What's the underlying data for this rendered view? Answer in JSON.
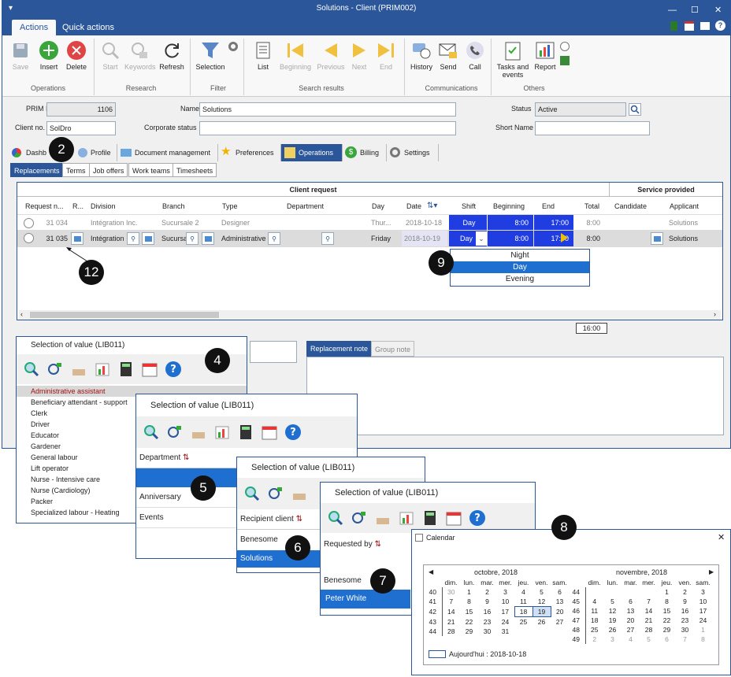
{
  "window": {
    "title": "Solutions - Client (PRIM002)",
    "menu_glyph": "▾"
  },
  "ribbon_tabs": [
    "Actions",
    "Quick actions"
  ],
  "ribbon": {
    "operations": {
      "label": "Operations",
      "save": "Save",
      "insert": "Insert",
      "delete": "Delete"
    },
    "research": {
      "label": "Research",
      "start": "Start",
      "keywords": "Keywords",
      "refresh": "Refresh"
    },
    "filter": {
      "label": "Filter",
      "selection": "Selection"
    },
    "search_results": {
      "label": "Search results",
      "list": "List",
      "beginning": "Beginning",
      "previous": "Previous",
      "next": "Next",
      "end": "End"
    },
    "communications": {
      "label": "Communications",
      "history": "History",
      "send": "Send",
      "call": "Call"
    },
    "others": {
      "label": "Others",
      "tasks_line1": "Tasks and",
      "tasks_line2": "events",
      "report": "Report"
    }
  },
  "form": {
    "prim_id_label": "PRIM ID",
    "prim_id": "1106",
    "name_label": "Name",
    "name": "Solutions",
    "status_label": "Status",
    "status": "Active",
    "client_no_label": "Client no.",
    "client_no": "SolDro",
    "corporate_status_label": "Corporate status",
    "corporate_status": "",
    "short_name_label": "Short Name",
    "short_name": ""
  },
  "main_tabs": [
    "Dashb",
    "Profile",
    "Document management",
    "Preferences",
    "Operations",
    "Billing",
    "Settings"
  ],
  "sub_tabs": [
    "Replacements",
    "Terms",
    "Job offers",
    "Work teams",
    "Timesheets"
  ],
  "grid": {
    "group_client": "Client request",
    "group_service": "Service provided",
    "columns": [
      "Request n...",
      "R...",
      "Division",
      "Branch",
      "Type",
      "Department",
      "Day",
      "Date",
      "Shift",
      "Beginning",
      "End",
      "Total",
      "Candidate",
      "Applicant"
    ],
    "rows": [
      {
        "request": "31 034",
        "division": "Intégration Inc.",
        "branch": "Sucursale 2",
        "type": "Designer",
        "department": "",
        "day": "Thur...",
        "date": "2018-10-18",
        "shift": "Day",
        "beginning": "8:00",
        "end": "17:00",
        "total": "8:00",
        "candidate": "",
        "applicant": "Solutions"
      },
      {
        "request": "31 035",
        "division": "Intégration",
        "branch": "Sucursa",
        "type": "Administrative",
        "department": "",
        "day": "Friday",
        "date": "2018-10-19",
        "shift": "Day",
        "beginning": "8:00",
        "end": "17:00",
        "total": "8:00",
        "candidate": "",
        "applicant": "Solutions"
      }
    ],
    "shift_options": [
      "Night",
      "Day",
      "Evening"
    ],
    "time_box": "16:00"
  },
  "notes_tabs": [
    "Replacement note",
    "Group note"
  ],
  "panels": {
    "p4": {
      "title": "Selection of value (LIB011)",
      "items": [
        "Administrative assistant",
        "Beneficiary attendant - support",
        "Clerk",
        "Driver",
        "Educator",
        "Gardener",
        "General labour",
        "Lift operator",
        "Nurse - Intensive care",
        "Nurse (Cardiology)",
        "Packer",
        "Specialized labour - Heating"
      ]
    },
    "p5": {
      "title": "Selection of value (LIB011)",
      "header": "Department",
      "items": [
        "",
        "Anniversary",
        "Events"
      ]
    },
    "p6": {
      "title": "Selection of value (LIB011)",
      "header": "Recipient client",
      "items": [
        "Benesome",
        "Solutions"
      ]
    },
    "p7": {
      "title": "Selection of value (LIB011)",
      "header": "Requested by",
      "items": [
        "Benesome",
        "Peter White"
      ]
    }
  },
  "calendar": {
    "title": "Calendar",
    "close": "✕",
    "month1": "octobre, 2018",
    "month2": "novembre, 2018",
    "weekdays": [
      "dim.",
      "lun.",
      "mar.",
      "mer.",
      "jeu.",
      "ven.",
      "sam."
    ],
    "oct_weeks": [
      [
        "40",
        "30",
        "1",
        "2",
        "3",
        "4",
        "5",
        "6"
      ],
      [
        "41",
        "7",
        "8",
        "9",
        "10",
        "11",
        "12",
        "13"
      ],
      [
        "42",
        "14",
        "15",
        "16",
        "17",
        "18",
        "19",
        "20"
      ],
      [
        "43",
        "21",
        "22",
        "23",
        "24",
        "25",
        "26",
        "27"
      ],
      [
        "44",
        "28",
        "29",
        "30",
        "31",
        "",
        "",
        ""
      ]
    ],
    "nov_weeks": [
      [
        "44",
        "",
        "",
        "",
        "",
        "1",
        "2",
        "3"
      ],
      [
        "45",
        "4",
        "5",
        "6",
        "7",
        "8",
        "9",
        "10"
      ],
      [
        "46",
        "11",
        "12",
        "13",
        "14",
        "15",
        "16",
        "17"
      ],
      [
        "47",
        "18",
        "19",
        "20",
        "21",
        "22",
        "23",
        "24"
      ],
      [
        "48",
        "25",
        "26",
        "27",
        "28",
        "29",
        "30",
        "1"
      ],
      [
        "49",
        "2",
        "3",
        "4",
        "5",
        "6",
        "7",
        "8"
      ]
    ],
    "today": "Aujourd'hui : 2018-10-18"
  },
  "callouts": [
    "2",
    "4",
    "5",
    "6",
    "7",
    "8",
    "9",
    "12"
  ]
}
